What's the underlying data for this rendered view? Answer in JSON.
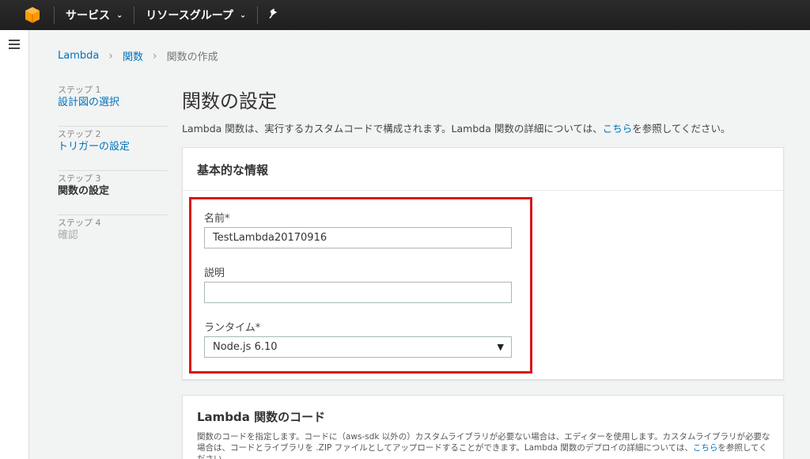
{
  "topnav": {
    "services_label": "サービス",
    "resource_groups_label": "リソースグループ"
  },
  "breadcrumb": {
    "root": "Lambda",
    "functions": "関数",
    "current": "関数の作成"
  },
  "steps": [
    {
      "num": "ステップ 1",
      "label": "設計図の選択"
    },
    {
      "num": "ステップ 2",
      "label": "トリガーの設定"
    },
    {
      "num": "ステップ 3",
      "label": "関数の設定"
    },
    {
      "num": "ステップ 4",
      "label": "確認"
    }
  ],
  "main": {
    "title": "関数の設定",
    "desc_prefix": "Lambda 関数は、実行するカスタムコードで構成されます。Lambda 関数の詳細については、",
    "desc_link": "こちら",
    "desc_suffix": "を参照してください。"
  },
  "basic_info": {
    "header": "基本的な情報",
    "name_label": "名前*",
    "name_value": "TestLambda20170916",
    "description_label": "説明",
    "description_value": "",
    "runtime_label": "ランタイム*",
    "runtime_value": "Node.js 6.10"
  },
  "code_section": {
    "header": "Lambda 関数のコード",
    "desc_prefix": "関数のコードを指定します。コードに（aws-sdk 以外の）カスタムライブラリが必要ない場合は、エディターを使用します。カスタムライブラリが必要な場合は、コードとライブラリを .ZIP ファイルとしてアップロードすることができます。Lambda 関数のデプロイの詳細については、",
    "desc_link": "こちら",
    "desc_suffix": "を参照してください。"
  },
  "colors": {
    "link": "#0073bb",
    "highlight": "#d9131b",
    "nav_bg": "#232323",
    "logo": "#f90"
  },
  "icons": [
    "aws-logo-icon",
    "chevron-down-icon",
    "pin-icon",
    "hamburger-icon",
    "chevron-right-icon",
    "dropdown-arrow-icon"
  ]
}
